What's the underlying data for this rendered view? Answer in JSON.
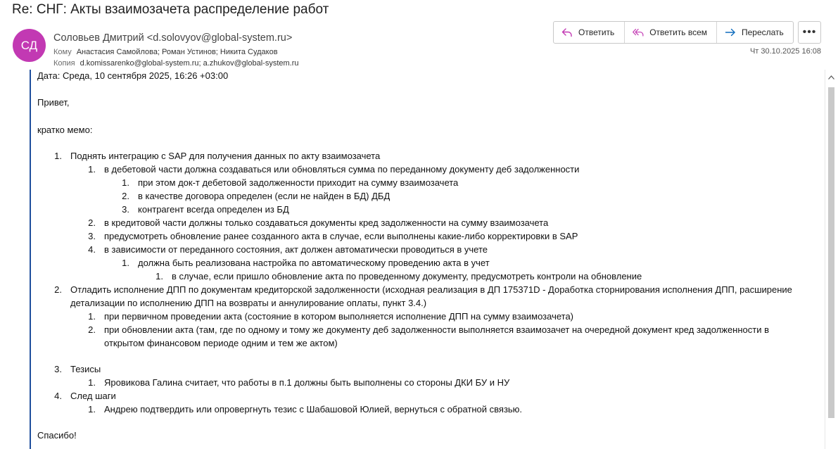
{
  "email": {
    "subject": "Re: СНГ: Акты взаимозачета распределение работ",
    "avatar_initials": "СД",
    "avatar_color": "#c239b3",
    "sender": "Соловьев Дмитрий <d.solovyov@global-system.ru>",
    "to_label": "Кому",
    "to": "Анастасия Самойлова; Роман Устинов; Никита Судаков",
    "cc_label": "Копия",
    "cc": "d.komissarenko@global-system.ru; a.zhukov@global-system.ru",
    "date": "Чт 30.10.2025 16:08"
  },
  "actions": {
    "reply": "Ответить",
    "reply_all": "Ответить всем",
    "forward": "Переслать",
    "more": "•••",
    "reply_icon": "reply-icon",
    "reply_all_icon": "reply-all-icon",
    "forward_icon": "forward-icon",
    "accent_color": "#c239b3",
    "forward_color": "#0f6cbd"
  },
  "body": {
    "date_line": "Дата: Среда, 10 сентября 2025, 16:26 +03:00",
    "greeting": "Привет,",
    "intro": "кратко мемо:",
    "lines": [
      {
        "n": "1.",
        "text": "Поднять интеграцию с SAP для получения данных по акту взаимозачета"
      },
      {
        "n": "1.",
        "text": "в дебетовой части должна создаваться или обновляться сумма по переданному документу деб задолженности"
      },
      {
        "n": "1.",
        "text": "при этом док-т дебетовой задолженности приходит на сумму взаимозачета"
      },
      {
        "n": "2.",
        "text": "в качестве договора определен (если не найден в БД) ДБД"
      },
      {
        "n": "3.",
        "text": "контрагент всегда определен из БД"
      },
      {
        "n": "2.",
        "text": "в кредитовой части должны только создаваться документы кред задолженности на сумму взаимозачета"
      },
      {
        "n": "3.",
        "text": "предусмотреть обновление ранее созданного акта в случае, если выполнены какие-либо корректировки в SAP"
      },
      {
        "n": "4.",
        "text": "в зависимости от переданного состояния, акт должен автоматически проводиться в учете"
      },
      {
        "n": "1.",
        "text": "должна быть реализована настройка по автоматическому проведению акта в учет"
      },
      {
        "n": "1.",
        "text": "в случае, если пришло обновление акта по проведенному документу, предусмотреть контроли на обновление"
      },
      {
        "n": "2.",
        "text": "Отладить исполнение ДПП по документам кредиторской задолженности (исходная реализация в ДП 175371D - Доработка сторнирования исполнения ДПП, расширение"
      },
      {
        "n": "",
        "text": "детализации по исполнению ДПП на возвраты и аннулирование оплаты, пункт 3.4.)"
      },
      {
        "n": "1.",
        "text": "при первичном проведении акта (состояние в котором выполняется исполнение ДПП на сумму взаимозачета)"
      },
      {
        "n": "2.",
        "text": "при обновлении акта (там, где по одному и тому же документу деб задолженности выполняется взаимозачет на очередной документ кред задолженности в"
      },
      {
        "n": "",
        "text": "открытом финансовом периоде одним и тем же актом)"
      },
      {
        "n": "3.",
        "text": "Тезисы"
      },
      {
        "n": "1.",
        "text": "Яровикова Галина считает, что работы в п.1 должны быть выполнены со стороны ДКИ БУ и НУ"
      },
      {
        "n": "4.",
        "text": "След шаги"
      },
      {
        "n": "1.",
        "text": "Андрею подтвердить или опровергнуть тезис с Шабашовой Юлией, вернуться с обратной связью."
      }
    ],
    "closing": "Спасибо!"
  }
}
